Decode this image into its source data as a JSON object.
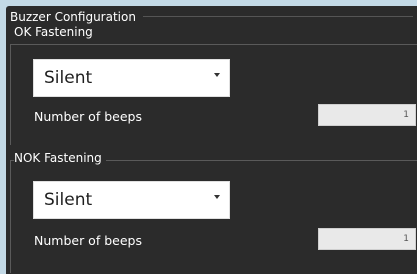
{
  "panel": {
    "title": "Buzzer Configuration"
  },
  "ok": {
    "group_title": "OK Fastening",
    "select_value": "Silent",
    "beeps_label": "Number of beeps",
    "beeps_value": "1"
  },
  "nok": {
    "group_title": "NOK Fastening",
    "select_value": "Silent",
    "beeps_label": "Number of beeps",
    "beeps_value": "1"
  },
  "icons": {
    "dropdown": "caret-down-icon"
  },
  "colors": {
    "background": "#c3d9e6",
    "panel": "#2b2b2b",
    "text": "#ffffff",
    "input_bg": "#e9e9e9"
  }
}
